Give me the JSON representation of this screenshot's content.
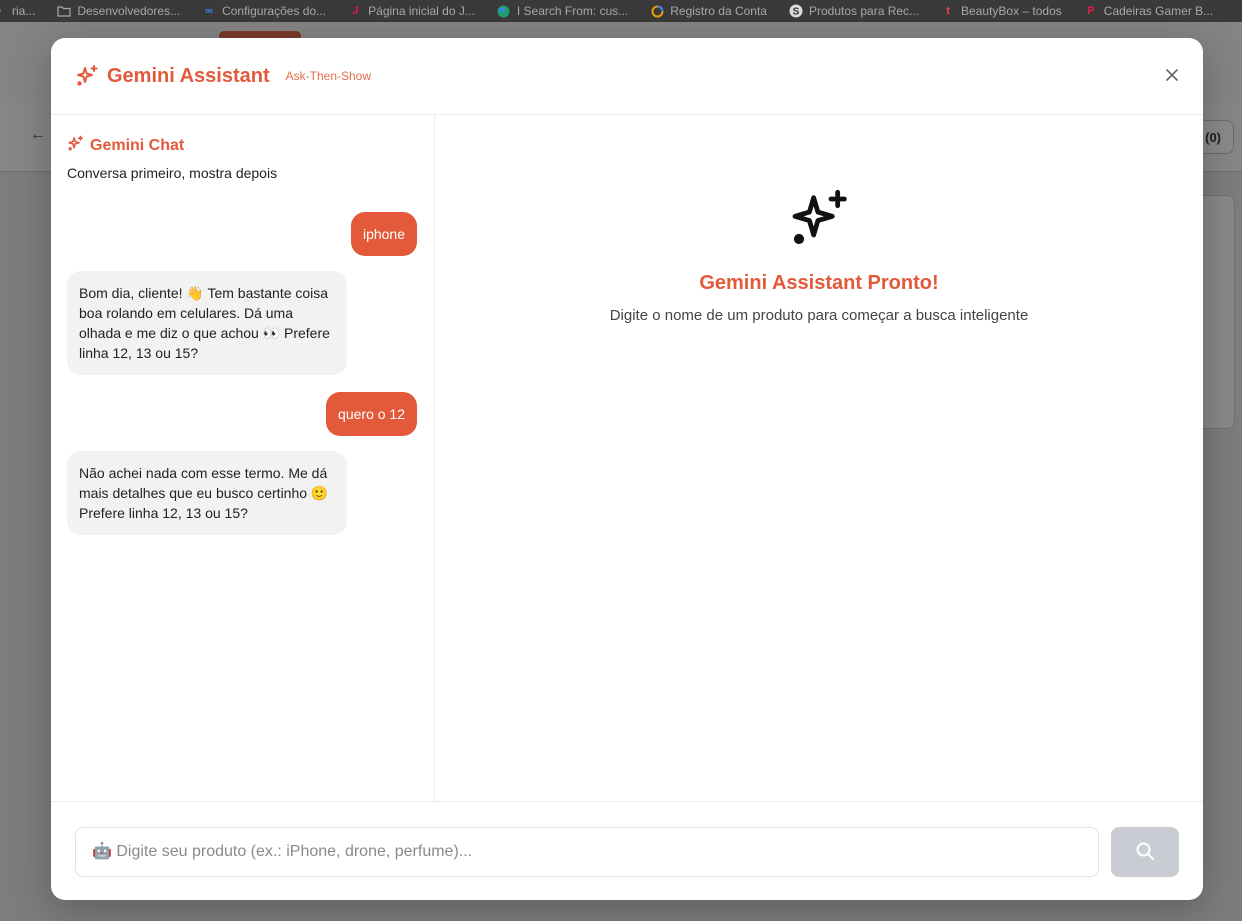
{
  "bookmarks": [
    {
      "label": "ria...",
      "icon": "generic-icon",
      "color": "#bbbbbb"
    },
    {
      "label": "Desenvolvedores...",
      "icon": "folder-icon",
      "color": "#bbbbbb"
    },
    {
      "label": "Configurações do...",
      "icon": "meta-icon",
      "color": "#3b82f6"
    },
    {
      "label": "Página inicial do J...",
      "icon": "j-icon",
      "color": "#e11d48"
    },
    {
      "label": "I Search From: cus...",
      "icon": "globe-icon",
      "color": "#22c55e"
    },
    {
      "label": "Registro da Conta",
      "icon": "ring-icon",
      "color": "#f59e0b"
    },
    {
      "label": "Produtos para Rec...",
      "icon": "s-icon",
      "color": "#dddddd"
    },
    {
      "label": "BeautyBox – todos",
      "icon": "t-icon",
      "color": "#ef4444"
    },
    {
      "label": "Cadeiras Gamer B...",
      "icon": "p-icon",
      "color": "#e11d48"
    }
  ],
  "background": {
    "cart_label": "(0)"
  },
  "modal": {
    "title": "Gemini Assistant",
    "subtitle": "Ask-Then-Show",
    "accent_color": "#e35a3a"
  },
  "chat": {
    "title": "Gemini Chat",
    "subtitle": "Conversa primeiro, mostra depois",
    "messages": [
      {
        "role": "user",
        "text": "iphone"
      },
      {
        "role": "bot",
        "text": "Bom dia, cliente! 👋 Tem bastante coisa boa rolando em celulares. Dá uma olhada e me diz o que achou 👀 Prefere linha 12, 13 ou 15?"
      },
      {
        "role": "user",
        "text": "quero o 12"
      },
      {
        "role": "bot",
        "text": "Não achei nada com esse termo. Me dá mais detalhes que eu busco certinho 🙂 Prefere linha 12, 13 ou 15?"
      }
    ]
  },
  "result": {
    "title": "Gemini Assistant Pronto!",
    "subtitle": "Digite o nome de um produto para começar a busca inteligente"
  },
  "input": {
    "placeholder": "🤖 Digite seu produto (ex.: iPhone, drone, perfume)...",
    "value": ""
  }
}
